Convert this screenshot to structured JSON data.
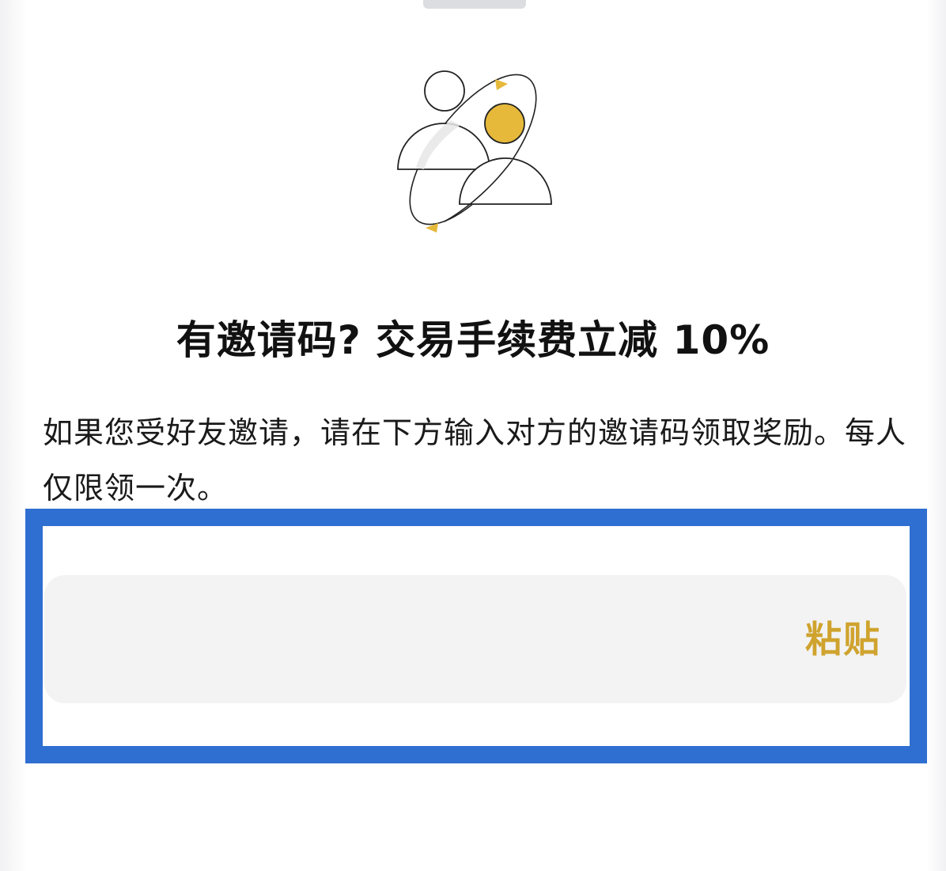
{
  "sheet": {
    "title": "有邀请码? 交易手续费立减 10%",
    "description": "如果您受好友邀请，请在下方输入对方的邀请码领取奖励。每人仅限领一次。"
  },
  "invite_code_field": {
    "value": "",
    "placeholder": "",
    "paste_label": "粘贴"
  },
  "colors": {
    "accent_gold": "#cfa32e",
    "highlight_blue": "#2f6fd2",
    "input_bg": "#f3f3f4"
  },
  "icons": {
    "illustration": "invite-friends-illustration-icon"
  }
}
